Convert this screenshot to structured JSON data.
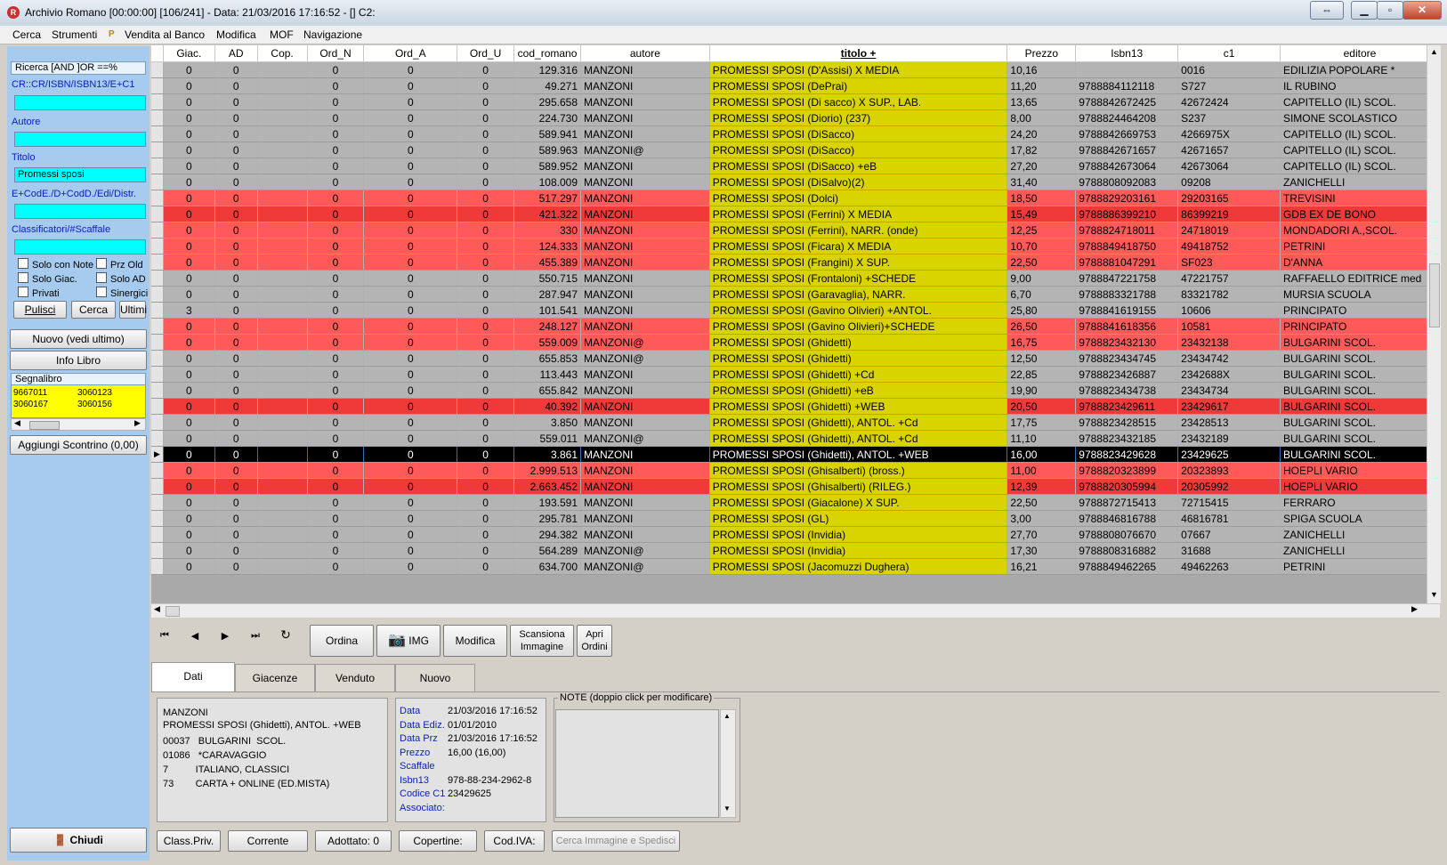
{
  "window": {
    "title": "Archivio Romano  [00:00:00] [106/241] - Data: 21/03/2016 17:16:52 - []  C2:",
    "restore_icon": "restore-arrows-icon"
  },
  "menu": [
    "Cerca",
    "Strumenti",
    "P",
    "Vendita al Banco",
    "Modifica",
    "MOF",
    "Navigazione"
  ],
  "search_panel": {
    "header": "Ricerca [AND  ]OR  ==%",
    "code_label": "CR::CR/ISBN/ISBN13/E+C1",
    "code_value": "",
    "author_label": "Autore",
    "author_value": "",
    "title_label": "Titolo",
    "title_value": "Promessi sposi",
    "editor_label": "E+CodE./D+CodD./Edi/Distr.",
    "editor_value": "",
    "class_label": "Classificatori/#Scaffale",
    "class_value": "",
    "checkboxes": [
      "Solo con Note",
      "Prz Old",
      "Solo Giac.",
      "Solo AD",
      "Privati",
      "Sinergici"
    ],
    "btn_clear": "Pulisci",
    "btn_search": "Cerca",
    "btn_last": "Ultimi"
  },
  "side_buttons": {
    "new": "Nuovo (vedi ultimo)",
    "info": "Info Libro",
    "bookmark_label": "Segnalibro",
    "bookmarks": [
      "9667011",
      "3060123",
      "3060167",
      "3060156"
    ],
    "add_receipt": "Aggiungi Scontrino (0,00)",
    "close": "Chiudi"
  },
  "grid": {
    "columns": [
      "Giac.",
      "AD",
      "Cop.",
      "Ord_N",
      "Ord_A",
      "Ord_U",
      "cod_romano",
      "autore",
      "titolo +",
      "Prezzo",
      "Isbn13",
      "c1",
      "editore"
    ],
    "rows": [
      {
        "s": "normal",
        "v": [
          "0",
          "0",
          "",
          "0",
          "0",
          "0",
          "129.316",
          "MANZONI",
          "PROMESSI SPOSI (D'Assisi) X MEDIA",
          "10,16",
          "",
          "0016",
          "EDILIZIA POPOLARE *"
        ]
      },
      {
        "s": "normal",
        "v": [
          "0",
          "0",
          "",
          "0",
          "0",
          "0",
          "49.271",
          "MANZONI",
          "PROMESSI SPOSI (DePrai)",
          "11,20",
          "9788884112118",
          "S727",
          "IL RUBINO"
        ]
      },
      {
        "s": "normal",
        "v": [
          "0",
          "0",
          "",
          "0",
          "0",
          "0",
          "295.658",
          "MANZONI",
          "PROMESSI SPOSI (Di sacco) X SUP., LAB.",
          "13,65",
          "9788842672425",
          "42672424",
          "CAPITELLO (IL) SCOL."
        ]
      },
      {
        "s": "normal",
        "v": [
          "0",
          "0",
          "",
          "0",
          "0",
          "0",
          "224.730",
          "MANZONI",
          "PROMESSI SPOSI (Diorio) (237)",
          "8,00",
          "9788824464208",
          "S237",
          "SIMONE SCOLASTICO"
        ]
      },
      {
        "s": "normal",
        "v": [
          "0",
          "0",
          "",
          "0",
          "0",
          "0",
          "589.941",
          "MANZONI",
          "PROMESSI SPOSI (DiSacco)",
          "24,20",
          "9788842669753",
          "4266975X",
          "CAPITELLO (IL) SCOL."
        ]
      },
      {
        "s": "normal",
        "v": [
          "0",
          "0",
          "",
          "0",
          "0",
          "0",
          "589.963",
          "MANZONI@",
          "PROMESSI SPOSI (DiSacco)",
          "17,82",
          "9788842671657",
          "42671657",
          "CAPITELLO (IL) SCOL."
        ]
      },
      {
        "s": "normal",
        "v": [
          "0",
          "0",
          "",
          "0",
          "0",
          "0",
          "589.952",
          "MANZONI",
          "PROMESSI SPOSI (DiSacco) +eB",
          "27,20",
          "9788842673064",
          "42673064",
          "CAPITELLO (IL) SCOL."
        ]
      },
      {
        "s": "normal",
        "v": [
          "0",
          "0",
          "",
          "0",
          "0",
          "0",
          "108.009",
          "MANZONI",
          "PROMESSI SPOSI (DiSalvo)(2)",
          "31,40",
          "9788808092083",
          "09208",
          "ZANICHELLI"
        ]
      },
      {
        "s": "red",
        "v": [
          "0",
          "0",
          "",
          "0",
          "0",
          "0",
          "517.297",
          "MANZONI",
          "PROMESSI SPOSI (Dolci)",
          "18,50",
          "9788829203161",
          "29203165",
          "TREVISINI"
        ]
      },
      {
        "s": "red-dark",
        "v": [
          "0",
          "0",
          "",
          "0",
          "0",
          "0",
          "421.322",
          "MANZONI",
          "PROMESSI SPOSI (Ferrini) X MEDIA",
          "15,49",
          "9788886399210",
          "86399219",
          "GDB EX DE BONO"
        ]
      },
      {
        "s": "red",
        "v": [
          "0",
          "0",
          "",
          "0",
          "0",
          "0",
          "330",
          "MANZONI",
          "PROMESSI SPOSI (Ferrini), NARR. (onde)",
          "12,25",
          "9788824718011",
          "24718019",
          "MONDADORI A.,SCOL."
        ]
      },
      {
        "s": "red",
        "v": [
          "0",
          "0",
          "",
          "0",
          "0",
          "0",
          "124.333",
          "MANZONI",
          "PROMESSI SPOSI (Ficara) X MEDIA",
          "10,70",
          "9788849418750",
          "49418752",
          "PETRINI"
        ]
      },
      {
        "s": "red",
        "v": [
          "0",
          "0",
          "",
          "0",
          "0",
          "0",
          "455.389",
          "MANZONI",
          "PROMESSI SPOSI (Frangini) X SUP.",
          "22,50",
          "9788881047291",
          "SF023",
          "D'ANNA"
        ]
      },
      {
        "s": "normal",
        "v": [
          "0",
          "0",
          "",
          "0",
          "0",
          "0",
          "550.715",
          "MANZONI",
          "PROMESSI SPOSI (Frontaloni) +SCHEDE",
          "9,00",
          "9788847221758",
          "47221757",
          "RAFFAELLO EDITRICE med"
        ]
      },
      {
        "s": "normal",
        "v": [
          "0",
          "0",
          "",
          "0",
          "0",
          "0",
          "287.947",
          "MANZONI",
          "PROMESSI SPOSI (Garavaglia), NARR.",
          "6,70",
          "9788883321788",
          "83321782",
          "MURSIA SCUOLA"
        ]
      },
      {
        "s": "normal",
        "v": [
          "3",
          "0",
          "",
          "0",
          "0",
          "0",
          "101.541",
          "MANZONI",
          "PROMESSI SPOSI (Gavino Olivieri) +ANTOL.",
          "25,80",
          "9788841619155",
          "10606",
          "PRINCIPATO"
        ]
      },
      {
        "s": "red",
        "v": [
          "0",
          "0",
          "",
          "0",
          "0",
          "0",
          "248.127",
          "MANZONI",
          "PROMESSI SPOSI (Gavino Olivieri)+SCHEDE",
          "26,50",
          "9788841618356",
          "10581",
          "PRINCIPATO"
        ]
      },
      {
        "s": "red",
        "v": [
          "0",
          "0",
          "",
          "0",
          "0",
          "0",
          "559.009",
          "MANZONI@",
          "PROMESSI SPOSI (Ghidetti)",
          "16,75",
          "9788823432130",
          "23432138",
          "BULGARINI  SCOL."
        ]
      },
      {
        "s": "normal",
        "v": [
          "0",
          "0",
          "",
          "0",
          "0",
          "0",
          "655.853",
          "MANZONI@",
          "PROMESSI SPOSI (Ghidetti)",
          "12,50",
          "9788823434745",
          "23434742",
          "BULGARINI  SCOL."
        ]
      },
      {
        "s": "normal",
        "v": [
          "0",
          "0",
          "",
          "0",
          "0",
          "0",
          "113.443",
          "MANZONI",
          "PROMESSI SPOSI (Ghidetti) +Cd",
          "22,85",
          "9788823426887",
          "2342688X",
          "BULGARINI  SCOL."
        ]
      },
      {
        "s": "normal",
        "v": [
          "0",
          "0",
          "",
          "0",
          "0",
          "0",
          "655.842",
          "MANZONI",
          "PROMESSI SPOSI (Ghidetti) +eB",
          "19,90",
          "9788823434738",
          "23434734",
          "BULGARINI  SCOL."
        ]
      },
      {
        "s": "red-dark",
        "v": [
          "0",
          "0",
          "",
          "0",
          "0",
          "0",
          "40.392",
          "MANZONI",
          "PROMESSI SPOSI (Ghidetti) +WEB",
          "20,50",
          "9788823429611",
          "23429617",
          "BULGARINI  SCOL."
        ]
      },
      {
        "s": "normal",
        "v": [
          "0",
          "0",
          "",
          "0",
          "0",
          "0",
          "3.850",
          "MANZONI",
          "PROMESSI SPOSI (Ghidetti), ANTOL. +Cd",
          "17,75",
          "9788823428515",
          "23428513",
          "BULGARINI  SCOL."
        ]
      },
      {
        "s": "normal",
        "v": [
          "0",
          "0",
          "",
          "0",
          "0",
          "0",
          "559.011",
          "MANZONI@",
          "PROMESSI SPOSI (Ghidetti), ANTOL. +Cd",
          "11,10",
          "9788823432185",
          "23432189",
          "BULGARINI  SCOL."
        ]
      },
      {
        "s": "sel",
        "v": [
          "0",
          "0",
          "",
          "0",
          "0",
          "0",
          "3.861",
          "MANZONI",
          "PROMESSI SPOSI (Ghidetti), ANTOL. +WEB",
          "16,00",
          "9788823429628",
          "23429625",
          "BULGARINI  SCOL."
        ]
      },
      {
        "s": "red",
        "v": [
          "0",
          "0",
          "",
          "0",
          "0",
          "0",
          "2.999.513",
          "MANZONI",
          "PROMESSI SPOSI (Ghisalberti) (bross.)",
          "11,00",
          "9788820323899",
          "20323893",
          "HOEPLI VARIO"
        ]
      },
      {
        "s": "red-dark",
        "v": [
          "0",
          "0",
          "",
          "0",
          "0",
          "0",
          "2.663.452",
          "MANZONI",
          "PROMESSI SPOSI (Ghisalberti) (RILEG.)",
          "12,39",
          "9788820305994",
          "20305992",
          "HOEPLI VARIO"
        ]
      },
      {
        "s": "normal",
        "v": [
          "0",
          "0",
          "",
          "0",
          "0",
          "0",
          "193.591",
          "MANZONI",
          "PROMESSI SPOSI (Giacalone) X SUP.",
          "22,50",
          "9788872715413",
          "72715415",
          "FERRARO"
        ]
      },
      {
        "s": "normal",
        "v": [
          "0",
          "0",
          "",
          "0",
          "0",
          "0",
          "295.781",
          "MANZONI",
          "PROMESSI SPOSI (GL)",
          "3,00",
          "9788846816788",
          "46816781",
          "SPIGA SCUOLA"
        ]
      },
      {
        "s": "normal",
        "v": [
          "0",
          "0",
          "",
          "0",
          "0",
          "0",
          "294.382",
          "MANZONI",
          "PROMESSI SPOSI (Invidia)",
          "27,70",
          "9788808076670",
          "07667",
          "ZANICHELLI"
        ]
      },
      {
        "s": "normal",
        "v": [
          "0",
          "0",
          "",
          "0",
          "0",
          "0",
          "564.289",
          "MANZONI@",
          "PROMESSI SPOSI (Invidia)",
          "17,30",
          "9788808316882",
          "31688",
          "ZANICHELLI"
        ]
      },
      {
        "s": "normal",
        "v": [
          "0",
          "0",
          "",
          "0",
          "0",
          "0",
          "634.700",
          "MANZONI@",
          "PROMESSI SPOSI (Jacomuzzi Dughera)",
          "16,21",
          "9788849462265",
          "49462263",
          "PETRINI"
        ]
      }
    ]
  },
  "toolbar": {
    "first": "⏮",
    "prev": "◀",
    "next": "▶",
    "last": "⏭",
    "refresh": "↻",
    "order": "Ordina",
    "img": "IMG",
    "edit": "Modifica",
    "scan_1": "Scansiona",
    "scan_2": "Immagine",
    "open_1": "Apri",
    "open_2": "Ordini"
  },
  "tabs": [
    "Dati",
    "Giacenze",
    "Venduto",
    "Nuovo"
  ],
  "details": {
    "lines": [
      "MANZONI",
      "PROMESSI SPOSI (Ghidetti), ANTOL. +WEB",
      "00037   BULGARINI  SCOL.",
      "01086   *CARAVAGGIO",
      "7          ITALIANO, CLASSICI",
      "73        CARTA + ONLINE (ED.MISTA)"
    ],
    "fields": [
      {
        "k": "Data",
        "v": "21/03/2016 17:16:52"
      },
      {
        "k": "Data Ediz.",
        "v": "01/01/2010"
      },
      {
        "k": "Data Prz",
        "v": "21/03/2016 17:16:52"
      },
      {
        "k": "Prezzo",
        "v": "16,00 (16,00)"
      },
      {
        "k": "Scaffale",
        "v": ""
      },
      {
        "k": "Isbn13",
        "v": "978-88-234-2962-8"
      },
      {
        "k": "Codice C1",
        "v": "23429625"
      },
      {
        "k": "Associato:",
        "v": ""
      }
    ],
    "notes_label": "NOTE (doppio click per modificare)",
    "notes_text": ""
  },
  "bottom_buttons": [
    "Class.Priv.",
    "Corrente",
    "Adottato: 0",
    "Copertine:",
    "Cod.IVA:",
    "Cerca Immagine e Spedisci"
  ],
  "colors": {
    "title_cell": "#d9d400",
    "row_normal": "#b4b4b4",
    "row_red": "#ff5a5a",
    "input_bg": "#00ffff",
    "panel_bg": "#a6cbef",
    "bookmark_bg": "#ffff00"
  }
}
